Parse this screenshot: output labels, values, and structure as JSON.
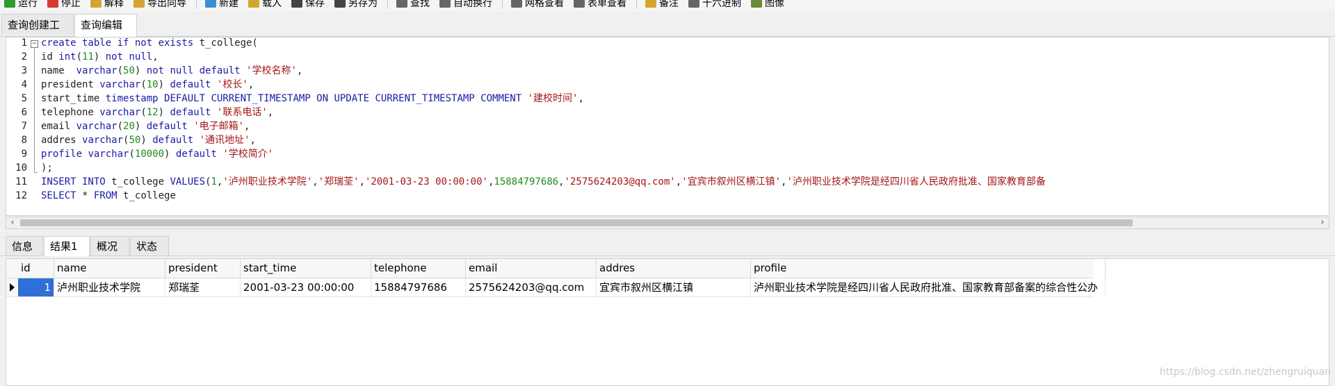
{
  "toolbar": {
    "buttons": [
      {
        "label": "运行",
        "icon": "run-icon",
        "color": "#2e9b2e"
      },
      {
        "label": "停止",
        "icon": "stop-icon",
        "color": "#d43a2f"
      },
      {
        "label": "解释",
        "icon": "explain-icon",
        "color": "#d4a62f"
      },
      {
        "label": "导出向导",
        "icon": "export-icon",
        "color": "#d4a62f"
      },
      {
        "label": "新建",
        "icon": "new-icon",
        "color": "#3a8fd4"
      },
      {
        "label": "载入",
        "icon": "load-icon",
        "color": "#d4a62f"
      },
      {
        "label": "保存",
        "icon": "save-icon",
        "color": "#444444"
      },
      {
        "label": "另存为",
        "icon": "save-as-icon",
        "color": "#444444"
      },
      {
        "label": "查找",
        "icon": "find-icon",
        "color": "#666666"
      },
      {
        "label": "自动换行",
        "icon": "wrap-icon",
        "color": "#666666"
      },
      {
        "label": "网格查看",
        "icon": "grid-view-icon",
        "color": "#666666"
      },
      {
        "label": "表单查看",
        "icon": "form-view-icon",
        "color": "#666666"
      },
      {
        "label": "备注",
        "icon": "memo-icon",
        "color": "#d4a62f"
      },
      {
        "label": "十六进制",
        "icon": "hex-icon",
        "color": "#666666"
      },
      {
        "label": "图像",
        "icon": "image-icon",
        "color": "#6a8a3a"
      }
    ]
  },
  "top_tabs": [
    "查询创建工具",
    "查询编辑器"
  ],
  "editor": {
    "line_numbers": [
      "1",
      "2",
      "3",
      "4",
      "5",
      "6",
      "7",
      "8",
      "9",
      "10",
      "11",
      "12"
    ],
    "lines": [
      [
        [
          "kw",
          "create table if not exists "
        ],
        [
          "plain",
          "t_college("
        ]
      ],
      [
        [
          "plain",
          "id "
        ],
        [
          "ty",
          "int"
        ],
        [
          "plain",
          "("
        ],
        [
          "num",
          "11"
        ],
        [
          "plain",
          ") "
        ],
        [
          "kw",
          "not null"
        ],
        [
          "plain",
          ","
        ]
      ],
      [
        [
          "plain",
          "name  "
        ],
        [
          "ty",
          "varchar"
        ],
        [
          "plain",
          "("
        ],
        [
          "num",
          "50"
        ],
        [
          "plain",
          ") "
        ],
        [
          "kw",
          "not null default "
        ],
        [
          "str",
          "'学校名称'"
        ],
        [
          "plain",
          ","
        ]
      ],
      [
        [
          "plain",
          "president "
        ],
        [
          "ty",
          "varchar"
        ],
        [
          "plain",
          "("
        ],
        [
          "num",
          "10"
        ],
        [
          "plain",
          ") "
        ],
        [
          "kw",
          "default "
        ],
        [
          "str",
          "'校长'"
        ],
        [
          "plain",
          ","
        ]
      ],
      [
        [
          "plain",
          "start_time "
        ],
        [
          "ty",
          "timestamp "
        ],
        [
          "kw",
          "DEFAULT CURRENT_TIMESTAMP ON UPDATE CURRENT_TIMESTAMP COMMENT "
        ],
        [
          "str",
          "'建校时间'"
        ],
        [
          "plain",
          ","
        ]
      ],
      [
        [
          "plain",
          "telephone "
        ],
        [
          "ty",
          "varchar"
        ],
        [
          "plain",
          "("
        ],
        [
          "num",
          "12"
        ],
        [
          "plain",
          ") "
        ],
        [
          "kw",
          "default "
        ],
        [
          "str",
          "'联系电话'"
        ],
        [
          "plain",
          ","
        ]
      ],
      [
        [
          "plain",
          "email "
        ],
        [
          "ty",
          "varchar"
        ],
        [
          "plain",
          "("
        ],
        [
          "num",
          "20"
        ],
        [
          "plain",
          ") "
        ],
        [
          "kw",
          "default "
        ],
        [
          "str",
          "'电子邮箱'"
        ],
        [
          "plain",
          ","
        ]
      ],
      [
        [
          "plain",
          "addres "
        ],
        [
          "ty",
          "varchar"
        ],
        [
          "plain",
          "("
        ],
        [
          "num",
          "50"
        ],
        [
          "plain",
          ") "
        ],
        [
          "kw",
          "default "
        ],
        [
          "str",
          "'通讯地址'"
        ],
        [
          "plain",
          ","
        ]
      ],
      [
        [
          "kw",
          "profile "
        ],
        [
          "ty",
          "varchar"
        ],
        [
          "plain",
          "("
        ],
        [
          "num",
          "10000"
        ],
        [
          "plain",
          ") "
        ],
        [
          "kw",
          "default "
        ],
        [
          "str",
          "'学校简介'"
        ]
      ],
      [
        [
          "plain",
          ");"
        ]
      ],
      [
        [
          "kw",
          "INSERT INTO "
        ],
        [
          "plain",
          "t_college "
        ],
        [
          "kw",
          "VALUES"
        ],
        [
          "plain",
          "("
        ],
        [
          "num",
          "1"
        ],
        [
          "plain",
          ","
        ],
        [
          "str",
          "'泸州职业技术学院'"
        ],
        [
          "plain",
          ","
        ],
        [
          "str",
          "'郑瑞荃'"
        ],
        [
          "plain",
          ","
        ],
        [
          "str",
          "'2001-03-23 00:00:00'"
        ],
        [
          "plain",
          ","
        ],
        [
          "num",
          "15884797686"
        ],
        [
          "plain",
          ","
        ],
        [
          "str",
          "'2575624203@qq.com'"
        ],
        [
          "plain",
          ","
        ],
        [
          "str",
          "'宜宾市叙州区横江镇'"
        ],
        [
          "plain",
          ","
        ],
        [
          "str",
          "'泸州职业技术学院是经四川省人民政府批准、国家教育部备"
        ]
      ],
      [
        [
          "kw",
          "SELECT "
        ],
        [
          "plain",
          "* "
        ],
        [
          "kw",
          "FROM "
        ],
        [
          "plain",
          "t_college"
        ]
      ]
    ]
  },
  "bottom_tabs": [
    "信息",
    "结果1",
    "概况",
    "状态"
  ],
  "result": {
    "columns": [
      "id",
      "name",
      "president",
      "start_time",
      "telephone",
      "email",
      "addres",
      "profile"
    ],
    "row": [
      "1",
      "泸州职业技术学院",
      "郑瑞荃",
      "2001-03-23 00:00:00",
      "15884797686",
      "2575624203@qq.com",
      "宜宾市叙州区横江镇",
      "泸州职业技术学院是经四川省人民政府批准、国家教育部备案的综合性公办"
    ]
  },
  "watermark": "https://blog.csdn.net/zhengruiquan"
}
